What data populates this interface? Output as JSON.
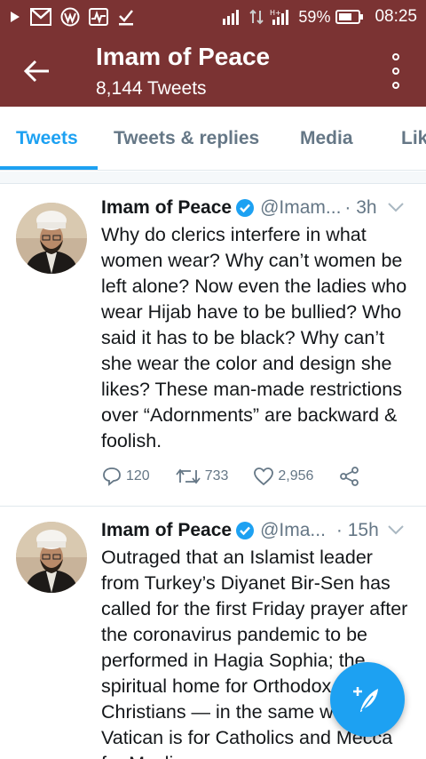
{
  "status_bar": {
    "battery_percent": "59%",
    "time": "08:25",
    "icons": [
      "play-icon",
      "gmail-icon",
      "wordpress-icon",
      "activity-icon",
      "download-done-icon",
      "signal-icon",
      "data-transfer-icon",
      "signal-h-icon",
      "battery-icon"
    ]
  },
  "app_bar": {
    "title": "Imam of Peace",
    "subtitle": "8,144 Tweets",
    "background": "#7b3333"
  },
  "tabs": {
    "items": [
      {
        "label": "Tweets",
        "active": true
      },
      {
        "label": "Tweets & replies",
        "active": false
      },
      {
        "label": "Media",
        "active": false
      },
      {
        "label": "Lik",
        "active": false
      }
    ],
    "accent": "#1da1f2"
  },
  "tweets": [
    {
      "name": "Imam of Peace",
      "handle": "@Imam...",
      "time": "· 3h",
      "text": "Why do clerics interfere in what women wear? Why can’t women be left alone? Now even the ladies who wear Hijab have to be bullied? Who said it has to be black? Why can’t she wear the color and design she likes? These man-made restrictions over “Adornments” are backward & foolish.",
      "replies": "120",
      "retweets": "733",
      "likes": "2,956"
    },
    {
      "name": "Imam of Peace",
      "handle": "@Ima...",
      "time": "· 15h",
      "text": "Outraged that an Islamist leader from Turkey’s Diyanet Bir-Sen has called for the first Friday prayer after the coronavirus pandemic to be performed in Hagia Sophia; the spiritual home for Orthodox Christians — in the same way Vatican is for Catholics and Mecca for Muslims."
    }
  ]
}
